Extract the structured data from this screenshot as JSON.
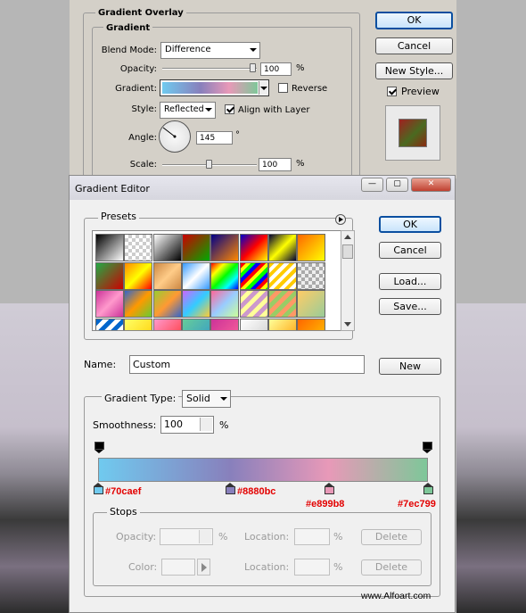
{
  "layer_style": {
    "section_title": "Gradient Overlay",
    "group_title": "Gradient",
    "blend_mode_label": "Blend Mode:",
    "blend_mode_value": "Difference",
    "opacity_label": "Opacity:",
    "opacity_value": "100",
    "opacity_unit": "%",
    "gradient_label": "Gradient:",
    "reverse_label": "Reverse",
    "style_label": "Style:",
    "style_value": "Reflected",
    "align_label": "Align with Layer",
    "angle_label": "Angle:",
    "angle_value": "145",
    "angle_unit": "°",
    "scale_label": "Scale:",
    "scale_value": "100",
    "scale_unit": "%",
    "ok": "OK",
    "cancel": "Cancel",
    "new_style": "New Style...",
    "preview_label": "Preview",
    "opacity_level": 0.96,
    "scale_level": 0.5
  },
  "gradient_editor": {
    "title": "Gradient Editor",
    "presets_label": "Presets",
    "ok": "OK",
    "cancel": "Cancel",
    "load": "Load...",
    "save": "Save...",
    "name_label": "Name:",
    "name_value": "Custom",
    "new_button": "New",
    "gradient_type_label": "Gradient Type:",
    "gradient_type_value": "Solid",
    "smoothness_label": "Smoothness:",
    "smoothness_value": "100",
    "smoothness_unit": "%",
    "stops_label": "Stops",
    "stops_opacity_label": "Opacity:",
    "stops_location_label": "Location:",
    "stops_color_label": "Color:",
    "stops_unit": "%",
    "delete_label": "Delete",
    "color_stops": [
      {
        "hex": "#70caef",
        "location": 0
      },
      {
        "hex": "#8880bc",
        "location": 40
      },
      {
        "hex": "#e899b8",
        "location": 70
      },
      {
        "hex": "#7ec799",
        "location": 100
      }
    ]
  },
  "watermark": "www.Alfoart.com",
  "colors": {
    "dialog_bg": "#d4d0c8",
    "editor_bg": "#f0f0f0",
    "accent": "#0b4fa0",
    "hex_label": "#e30000"
  }
}
